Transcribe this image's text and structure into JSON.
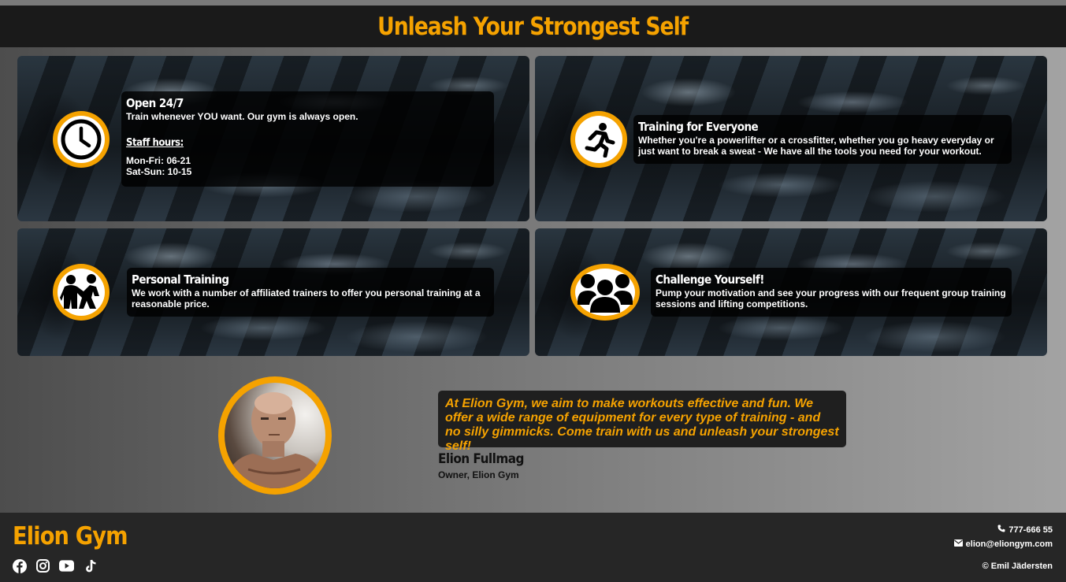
{
  "header": {
    "title": "Unleash Your Strongest Self"
  },
  "features": [
    {
      "title": "Open 24/7",
      "text": "Train whenever YOU want. Our gym is always open.",
      "subheading": "Staff hours:",
      "hours": [
        "Mon-Fri: 06-21",
        "Sat-Sun: 10-15"
      ],
      "icon": "clock-icon"
    },
    {
      "title": "Training for Everyone",
      "text": "Whether you're a powerlifter or a crossfitter, whether you go heavy everyday or just want to break a sweat - We have all the tools you need for your workout.",
      "icon": "running-person-icon"
    },
    {
      "title": "Personal Training",
      "text": "We work with a number of affiliated trainers to offer you personal training at a reasonable price.",
      "icon": "personal-trainer-icon"
    },
    {
      "title": "Challenge Yourself!",
      "text": "Pump your motivation and see your progress with our frequent group training sessions and lifting competitions.",
      "icon": "group-icon"
    }
  ],
  "testimonial": {
    "quote": "At Elion Gym, we aim to make workouts effective and fun. We offer a wide range of equipment for every type of training - and no silly gimmicks. Come train with us and unleash your strongest self!",
    "name": "Elion Fullmag",
    "role": "Owner, Elion Gym"
  },
  "footer": {
    "brand": "Elion Gym",
    "phone": "777-666 55",
    "email": "elion@eliongym.com",
    "copyright": "© Emil Jädersten",
    "social": [
      "facebook-icon",
      "instagram-icon",
      "youtube-icon",
      "tiktok-icon"
    ]
  },
  "colors": {
    "accent": "#f5a200",
    "header_bg": "#1a1a1a",
    "footer_bg": "#262626"
  }
}
